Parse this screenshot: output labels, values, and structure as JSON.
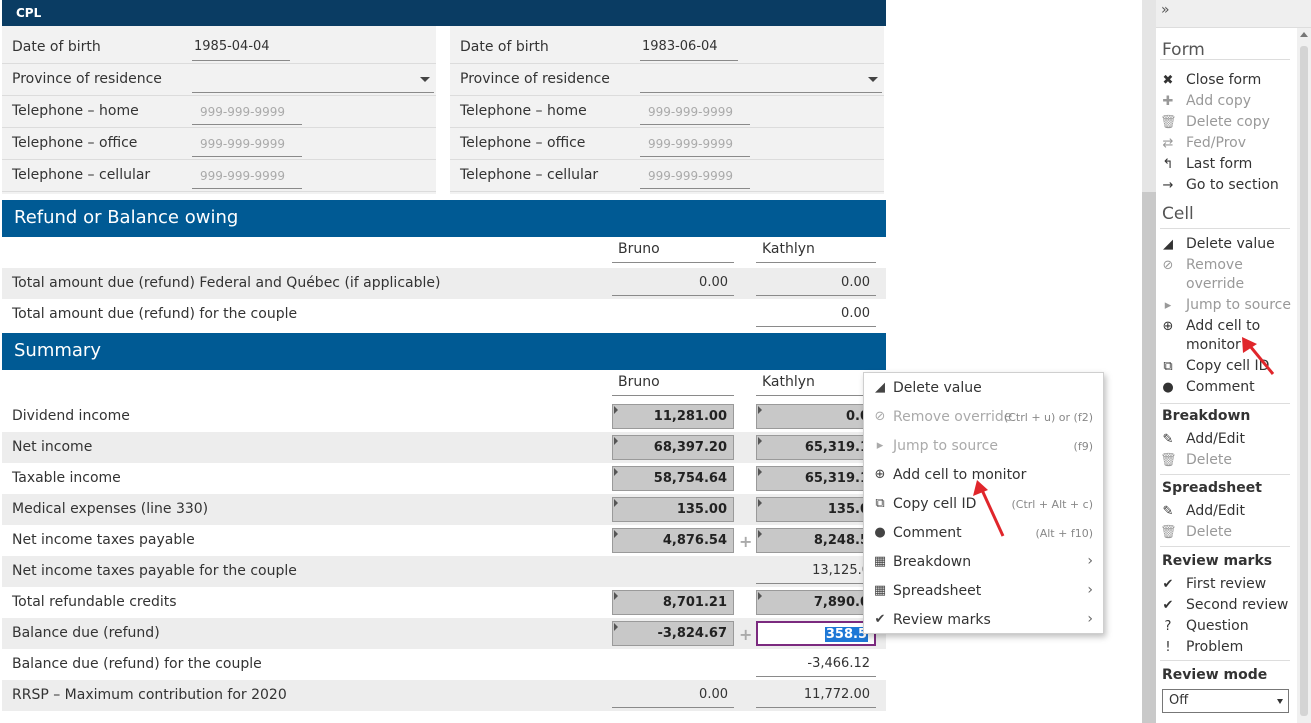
{
  "top_bar": {
    "label": "CPL"
  },
  "left_person": {
    "rows": [
      {
        "label": "Date of birth",
        "kind": "value",
        "value": "1985-04-04"
      },
      {
        "label": "Province of residence",
        "kind": "select",
        "value": ""
      },
      {
        "label": "Telephone – home",
        "kind": "placeholder",
        "value": "999-999-9999"
      },
      {
        "label": "Telephone – office",
        "kind": "placeholder",
        "value": "999-999-9999"
      },
      {
        "label": "Telephone – cellular",
        "kind": "placeholder",
        "value": "999-999-9999"
      }
    ]
  },
  "right_person": {
    "rows": [
      {
        "label": "Date of birth",
        "kind": "value",
        "value": "1983-06-04"
      },
      {
        "label": "Province of residence",
        "kind": "select",
        "value": ""
      },
      {
        "label": "Telephone – home",
        "kind": "placeholder",
        "value": "999-999-9999"
      },
      {
        "label": "Telephone – office",
        "kind": "placeholder",
        "value": "999-999-9999"
      },
      {
        "label": "Telephone – cellular",
        "kind": "placeholder",
        "value": "999-999-9999"
      }
    ]
  },
  "refund_section": {
    "title": "Refund or Balance owing",
    "col1": "Bruno",
    "col2": "Kathlyn",
    "rows": [
      {
        "label": "Total amount due (refund) Federal and Québec (if applicable)",
        "v1": "0.00",
        "v2": "0.00"
      },
      {
        "label": "Total amount due (refund) for the couple",
        "v1": "",
        "v2": "0.00"
      }
    ]
  },
  "summary_section": {
    "title": "Summary",
    "col1": "Bruno",
    "col2": "Kathlyn",
    "rows": [
      {
        "label": "Dividend income",
        "v1": "11,281.00",
        "v2": "0.0",
        "t1": "calc",
        "t2": "calc"
      },
      {
        "label": "Net income",
        "v1": "68,397.20",
        "v2": "65,319.1",
        "t1": "calc",
        "t2": "calc"
      },
      {
        "label": "Taxable income",
        "v1": "58,754.64",
        "v2": "65,319.1",
        "t1": "calc",
        "t2": "calc"
      },
      {
        "label": "Medical expenses (line 330)",
        "v1": "135.00",
        "v2": "135.0",
        "t1": "calc",
        "t2": "calc"
      },
      {
        "label": "Net income taxes payable",
        "v1": "4,876.54",
        "v2": "8,248.5",
        "t1": "calc",
        "t2": "calc",
        "plus": true
      },
      {
        "label": "Net income taxes payable for the couple",
        "v1": "",
        "v2": "13,125.0",
        "t1": "none",
        "t2": "plain"
      },
      {
        "label": "Total refundable credits",
        "v1": "8,701.21",
        "v2": "7,890.0",
        "t1": "calc",
        "t2": "calc"
      },
      {
        "label": "Balance due (refund)",
        "v1": "-3,824.67",
        "v2": "358.5",
        "t1": "calc",
        "t2": "selected",
        "plus": true
      },
      {
        "label": "Balance due (refund) for the couple",
        "v1": "",
        "v2": "-3,466.12",
        "t1": "none",
        "t2": "plain"
      },
      {
        "label": "RRSP – Maximum contribution for 2020",
        "v1": "0.00",
        "v2": "11,772.00",
        "t1": "plain",
        "t2": "plain"
      }
    ]
  },
  "context_menu": {
    "items": [
      {
        "icon": "eraser-icon",
        "glyph": "◢",
        "label": "Delete value",
        "shortcut": "",
        "submenu": false,
        "disabled": false
      },
      {
        "icon": "ban-icon",
        "glyph": "⊘",
        "label": "Remove override",
        "shortcut": "(Ctrl + u) or (f2)",
        "submenu": false,
        "disabled": true
      },
      {
        "icon": "caret-right-icon",
        "glyph": "▸",
        "label": "Jump to source",
        "shortcut": "(f9)",
        "submenu": false,
        "disabled": true
      },
      {
        "icon": "plus-circle-icon",
        "glyph": "⊕",
        "label": "Add cell to monitor",
        "shortcut": "",
        "submenu": false,
        "disabled": false
      },
      {
        "icon": "copy-icon",
        "glyph": "⧉",
        "label": "Copy cell ID",
        "shortcut": "(Ctrl + Alt + c)",
        "submenu": false,
        "disabled": false
      },
      {
        "icon": "comment-icon",
        "glyph": "●",
        "label": "Comment",
        "shortcut": "(Alt + f10)",
        "submenu": false,
        "disabled": false
      },
      {
        "icon": "table-icon",
        "glyph": "▦",
        "label": "Breakdown",
        "shortcut": "",
        "submenu": true,
        "disabled": false
      },
      {
        "icon": "spreadsheet-icon",
        "glyph": "▦",
        "label": "Spreadsheet",
        "shortcut": "",
        "submenu": true,
        "disabled": false
      },
      {
        "icon": "double-check-icon",
        "glyph": "✔",
        "label": "Review marks",
        "shortcut": "",
        "submenu": true,
        "disabled": false
      }
    ],
    "submenu_glyph": "›"
  },
  "sidebar": {
    "collapse_glyph": "»",
    "form_title": "Form",
    "form_items": [
      {
        "icon": "close-icon",
        "glyph": "✖",
        "label": "Close form",
        "disabled": false
      },
      {
        "icon": "plus-icon",
        "glyph": "✚",
        "label": "Add copy",
        "disabled": true
      },
      {
        "icon": "trash-icon",
        "glyph": "🗑",
        "label": "Delete copy",
        "disabled": true
      },
      {
        "icon": "swap-icon",
        "glyph": "⇄",
        "label": "Fed/Prov",
        "disabled": true
      },
      {
        "icon": "undo-icon",
        "glyph": "↰",
        "label": "Last form",
        "disabled": false
      },
      {
        "icon": "arrow-right-icon",
        "glyph": "→",
        "label": "Go to section",
        "disabled": false
      }
    ],
    "cell_title": "Cell",
    "cell_items": [
      {
        "icon": "eraser-icon",
        "glyph": "◢",
        "label": "Delete value",
        "disabled": false
      },
      {
        "icon": "ban-icon",
        "glyph": "⊘",
        "label": "Remove override",
        "disabled": true
      },
      {
        "icon": "caret-right-icon",
        "glyph": "▸",
        "label": "Jump to source",
        "disabled": true
      },
      {
        "icon": "plus-circle-icon",
        "glyph": "⊕",
        "label": "Add cell to monitor",
        "disabled": false
      },
      {
        "icon": "copy-icon",
        "glyph": "⧉",
        "label": "Copy cell ID",
        "disabled": false
      },
      {
        "icon": "comment-icon",
        "glyph": "●",
        "label": "Comment",
        "disabled": false
      }
    ],
    "breakdown_title": "Breakdown",
    "breakdown_items": [
      {
        "icon": "edit-icon",
        "glyph": "✎",
        "label": "Add/Edit",
        "disabled": false
      },
      {
        "icon": "trash-icon",
        "glyph": "🗑",
        "label": "Delete",
        "disabled": true
      }
    ],
    "spreadsheet_title": "Spreadsheet",
    "spreadsheet_items": [
      {
        "icon": "edit-icon",
        "glyph": "✎",
        "label": "Add/Edit",
        "disabled": false
      },
      {
        "icon": "trash-icon",
        "glyph": "🗑",
        "label": "Delete",
        "disabled": true
      }
    ],
    "review_title": "Review marks",
    "review_items": [
      {
        "icon": "check-icon",
        "glyph": "✔",
        "label": "First review",
        "disabled": false
      },
      {
        "icon": "double-check-icon",
        "glyph": "✔",
        "label": "Second review",
        "disabled": false
      },
      {
        "icon": "question-icon",
        "glyph": "?",
        "label": "Question",
        "disabled": false
      },
      {
        "icon": "exclamation-icon",
        "glyph": "!",
        "label": "Problem",
        "disabled": false
      }
    ],
    "review_mode_title": "Review mode",
    "review_mode_value": "Off"
  },
  "colors": {
    "header_dark": "#0a3c63",
    "section_blue": "#005a94",
    "annotation_red": "#e0262b",
    "selected_border": "#7b2a7f",
    "selection_highlight": "#1e78d6"
  }
}
